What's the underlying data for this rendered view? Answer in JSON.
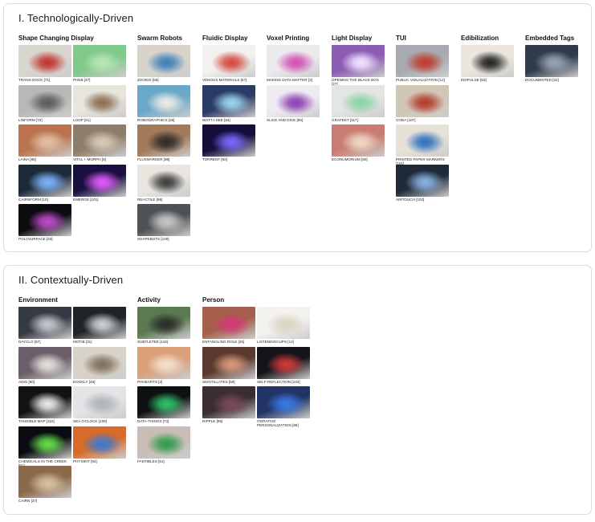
{
  "sections": [
    {
      "title": "I. Technologically-Driven",
      "columns": [
        {
          "title": "Shape Changing Display",
          "items": [
            {
              "label": "TRANS-DOCK [71]",
              "bg": "#d9d6cf",
              "accent": "#c0332b"
            },
            {
              "label": "PHEB [37]",
              "bg": "#7fc989",
              "accent": "#b9e6b7"
            },
            {
              "label": "LINFORM [72]",
              "bg": "#b8b8b6",
              "accent": "#5a5a58"
            },
            {
              "label": "LOOP [61]",
              "bg": "#e8e4de",
              "accent": "#8a6d52"
            },
            {
              "label": "LAINA [85]",
              "bg": "#b9734f",
              "accent": "#e3c1a5"
            },
            {
              "label": "VITAL + MORPH [5]",
              "bg": "#8e7d6a",
              "accent": "#d8cbb7"
            },
            {
              "label": "CAIRNFORM [10]",
              "bg": "#1d2a3a",
              "accent": "#7fb5ff"
            },
            {
              "label": "EMERGE [101]",
              "bg": "#1a1040",
              "accent": "#e35cff"
            },
            {
              "label": "POLYSURFACE [33]",
              "bg": "#0d0b10",
              "accent": "#c04bd0"
            }
          ]
        },
        {
          "title": "Swarm Robots",
          "items": [
            {
              "label": "ZOOIDS [58]",
              "bg": "#d8d4cc",
              "accent": "#3d7cb8"
            },
            {
              "label": "ROBOGRAPHICS [29]",
              "bg": "#6aa7c9",
              "accent": "#f0ece3"
            },
            {
              "label": "FLUXMARKER [98]",
              "bg": "#a37a5a",
              "accent": "#2b2b2b"
            },
            {
              "label": "REACTILE [96]",
              "bg": "#e9e6e0",
              "accent": "#3a3a3a"
            },
            {
              "label": "SHAPEBOTS [100]",
              "bg": "#4f5255",
              "accent": "#c9c9c9"
            }
          ]
        },
        {
          "title": "Fluidic Display",
          "items": [
            {
              "label": "VENOUS MATERIALS [67]",
              "bg": "#f2f1ee",
              "accent": "#d2463c"
            },
            {
              "label": "WATT-I-SEE [84]",
              "bg": "#2a3b66",
              "accent": "#9fd9f0"
            },
            {
              "label": "TORRENT [92]",
              "bg": "#150e3a",
              "accent": "#7a6bff"
            }
          ]
        },
        {
          "title": "Voxel Printing",
          "items": [
            {
              "label": "MAKING DATA MATTER [3]",
              "bg": "#ebeaef",
              "accent": "#d24db2"
            },
            {
              "label": "SLICE AND DICE [86]",
              "bg": "#eeeaf2",
              "accent": "#8b3db0"
            }
          ]
        },
        {
          "title": "Light Display",
          "items": [
            {
              "label": "OPENING THE BLACK BOX [27]",
              "bg": "#8d5db6",
              "accent": "#f3e6ff"
            },
            {
              "label": "GRAFEET [117]",
              "bg": "#e4e6e4",
              "accent": "#8ad4a2"
            },
            {
              "label": "ECONUMORIUM [90]",
              "bg": "#c97d72",
              "accent": "#f0d9c8"
            }
          ]
        },
        {
          "title": "TUI",
          "items": [
            {
              "label": "PUBLIC VISUALIZATION [12]",
              "bg": "#a8aab0",
              "accent": "#c0392b"
            },
            {
              "label": "CODA [107]",
              "bg": "#d2c6b6",
              "accent": "#b23a2a"
            },
            {
              "label": "PRINTED PAPER MARKERS [101]",
              "bg": "#e6e2d8",
              "accent": "#2d6fc0"
            },
            {
              "label": "AIRTOUCH [102]",
              "bg": "#1f2a38",
              "accent": "#8ab4e6"
            }
          ]
        },
        {
          "title": "Edibilization",
          "items": [
            {
              "label": "EDIPULSE [53]",
              "bg": "#ebe7df",
              "accent": "#202020"
            }
          ]
        },
        {
          "title": "Embedded Tags",
          "items": [
            {
              "label": "DOCUMENTED [22]",
              "bg": "#2f3a4a",
              "accent": "#9aa7b8"
            }
          ]
        }
      ]
    },
    {
      "title": "II. Contextually-Driven",
      "columns": [
        {
          "title": "Environment",
          "items": [
            {
              "label": "DAYCLO [57]",
              "bg": "#353a44",
              "accent": "#c7c9cf"
            },
            {
              "label": "MOTIB [31]",
              "bg": "#1f2428",
              "accent": "#d0d4d8"
            },
            {
              "label": "ADIO [60]",
              "bg": "#6c5e68",
              "accent": "#e6e3dd"
            },
            {
              "label": "EOOKLY [45]",
              "bg": "#d8d3c8",
              "accent": "#7e6d5a"
            },
            {
              "label": "TANGIBLE MAP [110]",
              "bg": "#111214",
              "accent": "#efefef"
            },
            {
              "label": "SEA O'CLOCK [109]",
              "bg": "#e2e4e6",
              "accent": "#aeb2b8"
            },
            {
              "label": "CHEMICALS IN THE CREEK [81]",
              "bg": "#0b0b12",
              "accent": "#64e34a"
            },
            {
              "label": "PHYSIKIT [94]",
              "bg": "#d86b2a",
              "accent": "#3b7ad0"
            },
            {
              "label": "CAIRN [27]",
              "bg": "#8a6a4a",
              "accent": "#d6c2a2"
            }
          ]
        },
        {
          "title": "Activity",
          "items": [
            {
              "label": "SUBTLETEE [118]",
              "bg": "#5b7a52",
              "accent": "#2a2a2a"
            },
            {
              "label": "PHHEARTS [2]",
              "bg": "#d9a07a",
              "accent": "#f3e0cf"
            },
            {
              "label": "DATA-THINGS [73]",
              "bg": "#0e1112",
              "accent": "#2fc36a"
            },
            {
              "label": "FANTIBLES [51]",
              "bg": "#c8bdb6",
              "accent": "#2f9a4a"
            }
          ]
        },
        {
          "title": "Person",
          "items": [
            {
              "label": "ENTANGLING ROLE [25]",
              "bg": "#a4604a",
              "accent": "#d3397a"
            },
            {
              "label": "LISTENINGCUPS [14]",
              "bg": "#f3f2ef",
              "accent": "#d9d3c2"
            },
            {
              "label": "SKINTILLATES [59]",
              "bg": "#5a3a2e",
              "accent": "#d89a7a"
            },
            {
              "label": "SELF-REFLECTION [103]",
              "bg": "#14141a",
              "accent": "#d33a3a"
            },
            {
              "label": "RIPPLE [95]",
              "bg": "#3a2c30",
              "accent": "#7a4a58"
            },
            {
              "label": "ITERATIVE PERSONALIZATION [88]",
              "bg": "#223366",
              "accent": "#3a7ae6"
            }
          ]
        }
      ]
    }
  ]
}
